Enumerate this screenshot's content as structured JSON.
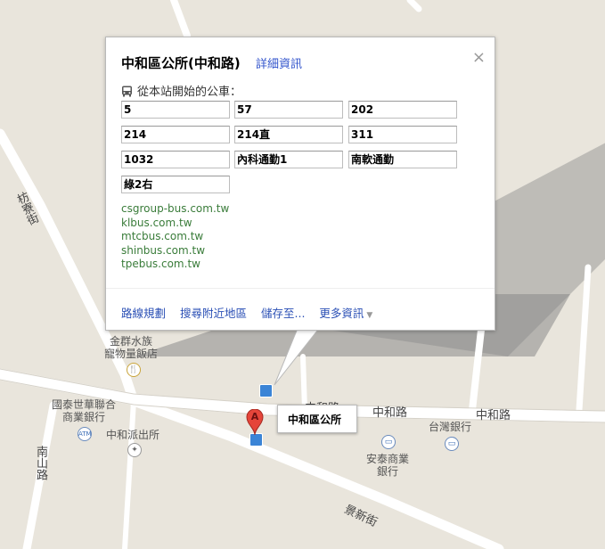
{
  "popup": {
    "title": "中和區公所(中和路)",
    "detail_link": "詳細資訊",
    "close_glyph": "×",
    "bus_heading": "從本站開始的公車：",
    "routes": [
      "5",
      "57",
      "202",
      "214",
      "214直",
      "311",
      "1032",
      "內科通勤1",
      "南軟通勤",
      "綠2右"
    ],
    "links": [
      "csgroup-bus.com.tw",
      "klbus.com.tw",
      "mtcbus.com.tw",
      "shinbus.com.tw",
      "tpebus.com.tw"
    ],
    "actions": {
      "directions": "路線規劃",
      "search_nearby": "搜尋附近地區",
      "save_to": "儲存至...",
      "more_info": "更多資訊"
    }
  },
  "marker": {
    "letter": "A",
    "label": "中和區公所"
  },
  "map_labels": {
    "fangliao_st": "枋寮街",
    "zhonghe_rd_1": "中和路",
    "zhonghe_rd_2": "中和路",
    "zhonghe_rd_3": "中和路",
    "nanshan_rd": "南山路",
    "jingxin_st": "景新街",
    "restaurant": "金群水族\n寵物量飯店",
    "bank_1": "國泰世華聯合\n商業銀行",
    "police": "中和派出所",
    "bank_taiwan": "台灣銀行",
    "bank_antai": "安泰商業\n銀行",
    "atm": "ATM"
  },
  "colors": {
    "map_bg": "#e9e5dc",
    "road": "#ffffff",
    "link_green": "#3a7c3a",
    "action_blue": "#2a4fb5",
    "marker_red": "#e5453a",
    "bus_blue": "#3b84d6"
  }
}
